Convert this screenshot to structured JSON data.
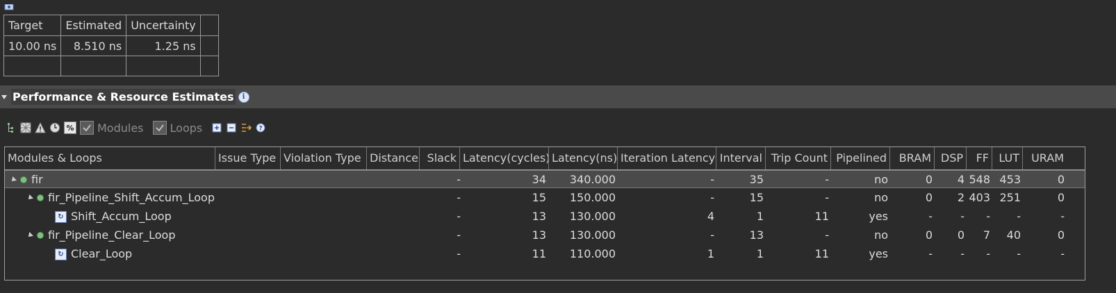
{
  "timing": {
    "headers": [
      "Target",
      "Estimated",
      "Uncertainty"
    ],
    "values": [
      "10.00 ns",
      "8.510 ns",
      "1.25 ns"
    ]
  },
  "section": {
    "title": "Performance & Resource Estimates"
  },
  "toolbar": {
    "modules_label": "Modules",
    "loops_label": "Loops",
    "percent_label": "%"
  },
  "grid": {
    "columns": [
      "Modules & Loops",
      "Issue Type",
      "Violation Type",
      "Distance",
      "Slack",
      "Latency(cycles)",
      "Latency(ns)",
      "Iteration Latency",
      "Interval",
      "Trip Count",
      "Pipelined",
      "BRAM",
      "DSP",
      "FF",
      "LUT",
      "URAM"
    ],
    "rows": [
      {
        "name": "fir",
        "slack": "-",
        "lat_cycles": "34",
        "lat_ns": "340.000",
        "iter_lat": "-",
        "interval": "35",
        "trip": "-",
        "pipelined": "no",
        "bram": "0",
        "dsp": "4",
        "ff": "548",
        "lut": "453",
        "uram": "0"
      },
      {
        "name": "fir_Pipeline_Shift_Accum_Loop",
        "slack": "-",
        "lat_cycles": "15",
        "lat_ns": "150.000",
        "iter_lat": "-",
        "interval": "15",
        "trip": "-",
        "pipelined": "no",
        "bram": "0",
        "dsp": "2",
        "ff": "403",
        "lut": "251",
        "uram": "0"
      },
      {
        "name": "Shift_Accum_Loop",
        "slack": "-",
        "lat_cycles": "13",
        "lat_ns": "130.000",
        "iter_lat": "4",
        "interval": "1",
        "trip": "11",
        "pipelined": "yes",
        "bram": "-",
        "dsp": "-",
        "ff": "-",
        "lut": "-",
        "uram": "-"
      },
      {
        "name": "fir_Pipeline_Clear_Loop",
        "slack": "-",
        "lat_cycles": "13",
        "lat_ns": "130.000",
        "iter_lat": "-",
        "interval": "13",
        "trip": "-",
        "pipelined": "no",
        "bram": "0",
        "dsp": "0",
        "ff": "7",
        "lut": "40",
        "uram": "0"
      },
      {
        "name": "Clear_Loop",
        "slack": "-",
        "lat_cycles": "11",
        "lat_ns": "110.000",
        "iter_lat": "1",
        "interval": "1",
        "trip": "11",
        "pipelined": "yes",
        "bram": "-",
        "dsp": "-",
        "ff": "-",
        "lut": "-",
        "uram": "-"
      }
    ]
  }
}
